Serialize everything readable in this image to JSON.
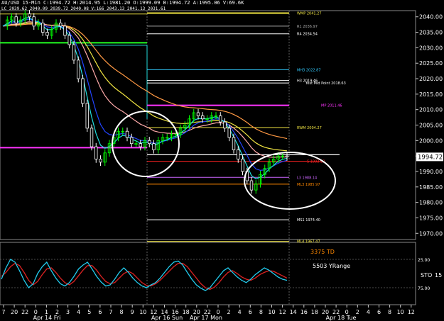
{
  "chart_data": {
    "type": "candlestick",
    "header": {
      "line1": "AU/USD 15-Min  C:1994.72  H:2014.95  L:1981.20  O:1999.09  B:1994.72  A:1995.06  V:69.6K",
      "line2": "LC 2039.62  2040.09  2039.72  2040.08  V:166  2043.13  2041.13  2031.61"
    },
    "price_axis": {
      "ticks": [
        "2040.00",
        "2035.00",
        "2030.00",
        "2025.00",
        "2020.00",
        "2015.00",
        "2010.00",
        "2005.00",
        "2000.00",
        "1995.00",
        "1990.00",
        "1985.00",
        "1980.00",
        "1975.00",
        "1970.00"
      ],
      "last_price": "1994.72",
      "ylim": [
        1968,
        2042
      ]
    },
    "time_axis": {
      "hour_ticks": [
        "7",
        "20",
        "22",
        "0",
        "1",
        "2",
        "3",
        "4",
        "5",
        "6",
        "7",
        "8",
        "9",
        "10",
        "12",
        "14",
        "16",
        "18",
        "20",
        "22",
        "0",
        "2",
        "4",
        "6",
        "8",
        "10",
        "12",
        "14",
        "16",
        "18",
        "20",
        "22",
        "0",
        "2",
        "4",
        "6",
        "8",
        "10",
        "12"
      ],
      "day_labels": [
        "Apr 14 Fri",
        "Apr 16 Sun",
        "Apr 17 Mon",
        "Apr 18 Tue"
      ]
    },
    "levels": [
      {
        "label": "WMP 2041.27",
        "price": 2041.2,
        "color": "#f0e442"
      },
      {
        "label": "R1 2036.97",
        "price": 2037.0,
        "color": "#aaaaaa"
      },
      {
        "label": "R4 2034.54",
        "price": 2034.5,
        "color": "#ffffff"
      },
      {
        "label": "MH3 2022.87",
        "price": 2022.9,
        "color": "#33ccff"
      },
      {
        "label": "H3 2019.46",
        "price": 2019.4,
        "color": "#ffffff"
      },
      {
        "label": "Yest Mid Point 2018.63",
        "price": 2018.6,
        "color": "#ffffff"
      },
      {
        "label": "MP 2011.46",
        "price": 2011.4,
        "color": "#ff33ff"
      },
      {
        "label": "RWM 2004.27",
        "price": 2004.2,
        "color": "#f0e442"
      },
      {
        "label": "S 1993.32",
        "price": 1993.3,
        "color": "#ff2222"
      },
      {
        "label": "L3 1988.14",
        "price": 1988.1,
        "color": "#cc66ff"
      },
      {
        "label": "ML3 1985.97",
        "price": 1985.9,
        "color": "#ff8800"
      },
      {
        "label": "MS1 1974.40",
        "price": 1974.4,
        "color": "#ffffff"
      },
      {
        "label": "ML4 1967.47",
        "price": 1967.4,
        "color": "#f0e442"
      }
    ],
    "price_series": [
      2037,
      2039,
      2040,
      2038,
      2039,
      2041,
      2040,
      2037,
      2038,
      2035,
      2034,
      2036,
      2038,
      2037,
      2034,
      2031,
      2026,
      2020,
      2012,
      2004,
      1998,
      1994,
      1993,
      1996,
      1999,
      2001,
      2003,
      2003,
      2001,
      1999,
      1999,
      1998,
      2000,
      1999,
      1997,
      2000,
      2001,
      2001,
      2002,
      2002,
      2004,
      2005,
      2007,
      2009,
      2008,
      2007,
      2007,
      2008,
      2008,
      2006,
      2004,
      2001,
      1997,
      1994,
      1990,
      1987,
      1984,
      1986,
      1989,
      1991,
      1993,
      1994,
      1995,
      1995,
      1994.7
    ],
    "indicator": {
      "label_td": "3375 TD",
      "label_range": "5503 YRange",
      "label_sto": "STO",
      "sto_value": "15",
      "ticks": [
        "25.00",
        "75.00"
      ],
      "k_line": [
        60,
        40,
        25,
        30,
        45,
        62,
        75,
        68,
        50,
        38,
        30,
        45,
        58,
        68,
        72,
        66,
        55,
        42,
        35,
        30,
        42,
        55,
        65,
        72,
        70,
        60,
        48,
        40,
        48,
        58,
        66,
        72,
        75,
        70,
        66,
        58,
        48,
        38,
        30,
        28,
        35,
        48,
        60,
        70,
        76,
        80,
        75,
        65,
        55,
        45,
        40,
        48,
        56,
        62,
        66,
        60,
        52,
        46,
        40,
        44,
        50,
        56,
        60,
        62
      ],
      "d_line": [
        55,
        48,
        38,
        32,
        36,
        48,
        62,
        70,
        64,
        52,
        42,
        40,
        48,
        58,
        66,
        70,
        64,
        54,
        44,
        36,
        36,
        44,
        55,
        64,
        68,
        66,
        58,
        50,
        46,
        50,
        58,
        66,
        71,
        72,
        68,
        62,
        54,
        46,
        38,
        32,
        32,
        38,
        48,
        58,
        68,
        75,
        78,
        74,
        66,
        56,
        48,
        45,
        50,
        56,
        60,
        62,
        58,
        52,
        48,
        45,
        46,
        50,
        54,
        58
      ]
    },
    "annotations": [
      "ellipse around Apr 14 low",
      "ellipse around Apr 17 low"
    ],
    "colors": {
      "up_candle": "#00ff00",
      "down_candle": "#ffffff",
      "sto_k": "#22ccee",
      "sto_d": "#dd2222",
      "ema_blue": "#2244ff",
      "ema_cyan": "#22dddd",
      "ma_pink": "#ffaaaa",
      "ma_orange": "#ff9944",
      "ma_yellow": "#f0e442"
    }
  }
}
